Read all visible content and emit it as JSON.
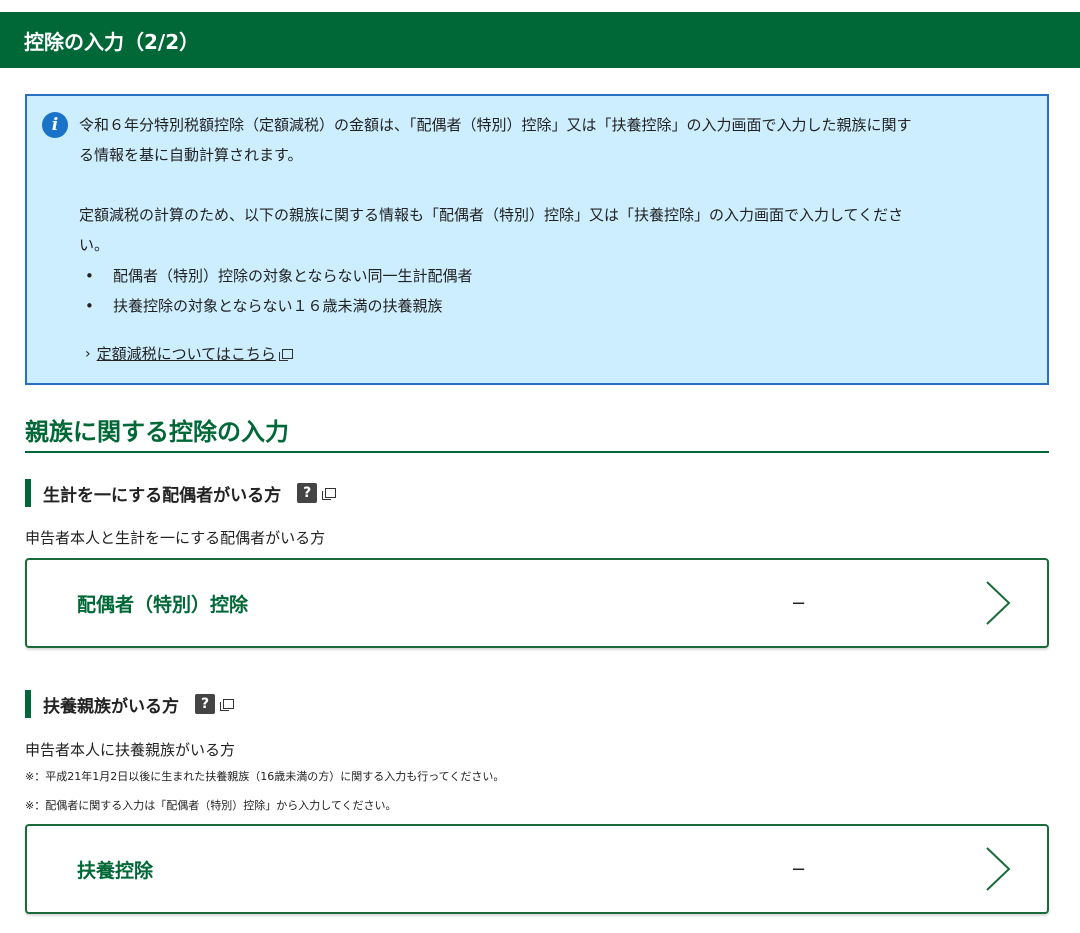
{
  "header": {
    "title": "控除の入力（2/2）"
  },
  "info": {
    "line1": "令和６年分特別税額控除（定額減税）の金額は、「配偶者（特別）控除」又は「扶養控除」の入力画面で入力した親族に関す",
    "line2": "る情報を基に自動計算されます。",
    "line3": "定額減税の計算のため、以下の親族に関する情報も「配偶者（特別）控除」又は「扶養控除」の入力画面で入力してくださ",
    "line4": "い。",
    "bullets": [
      "配偶者（特別）控除の対象とならない同一生計配偶者",
      "扶養控除の対象とならない１６歳未満の扶養親族"
    ],
    "link_text": "定額減税についてはこちら"
  },
  "section": {
    "title": "親族に関する控除の入力"
  },
  "spouse": {
    "heading": "生計を一にする配偶者がいる方",
    "description": "申告者本人と生計を一にする配偶者がいる方",
    "card_label": "配偶者（特別）控除",
    "card_value": "−"
  },
  "dependents": {
    "heading": "扶養親族がいる方",
    "description": "申告者本人に扶養親族がいる方",
    "note1": "※：平成21年1月2日以後に生まれた扶養親族（16歳未満の方）に関する入力も行ってください。",
    "note2": "※：配偶者に関する入力は「配偶者（特別）控除」から入力してください。",
    "card_label": "扶養控除",
    "card_value": "−"
  },
  "icons": {
    "info": "info-icon",
    "help": "help-icon",
    "external": "external-link-icon",
    "chevron": "chevron-right-icon"
  },
  "colors": {
    "brand_green": "#006837",
    "info_bg": "#cdeeff",
    "info_border": "#2a70c2"
  }
}
